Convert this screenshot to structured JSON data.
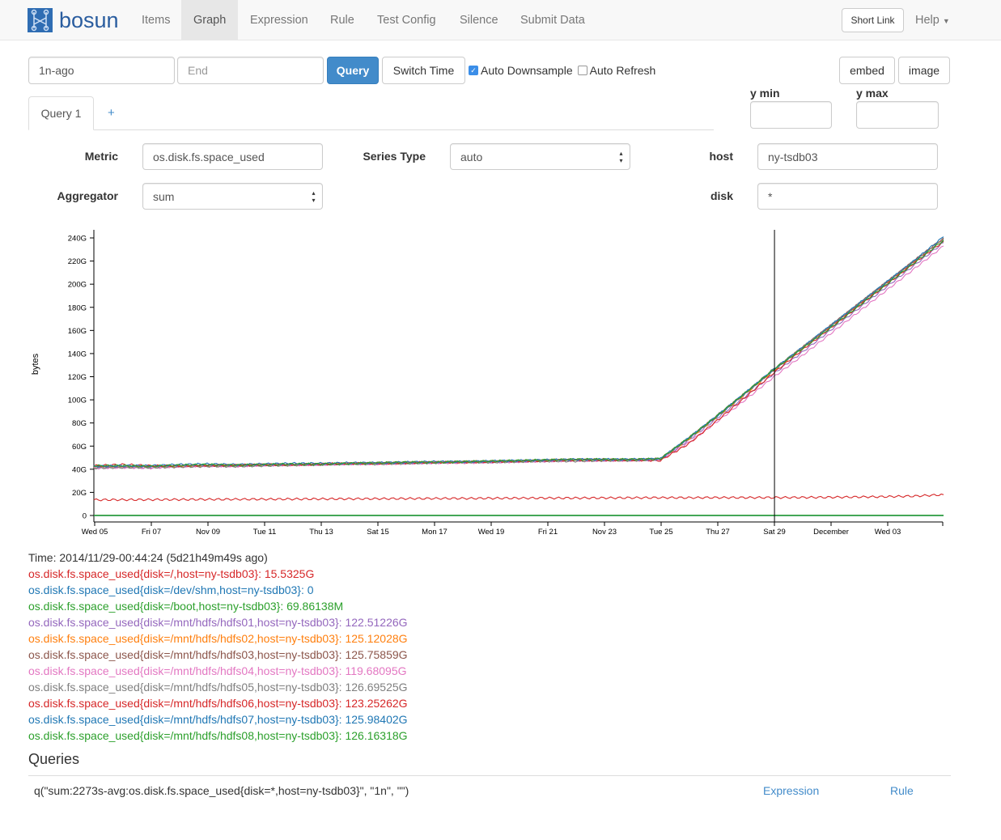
{
  "nav": {
    "brand": "bosun",
    "items": [
      "Items",
      "Graph",
      "Expression",
      "Rule",
      "Test Config",
      "Silence",
      "Submit Data"
    ],
    "active": "Graph",
    "short_link": "Short Link",
    "help": "Help"
  },
  "controls": {
    "start": "1n-ago",
    "end_placeholder": "End",
    "query": "Query",
    "switch_time": "Switch Time",
    "auto_downsample": "Auto Downsample",
    "auto_downsample_checked": true,
    "auto_refresh": "Auto Refresh",
    "auto_refresh_checked": false,
    "embed": "embed",
    "image": "image",
    "ymin_label": "y min",
    "ymax_label": "y max"
  },
  "tabs": {
    "query1": "Query 1",
    "add": "+"
  },
  "form": {
    "metric_label": "Metric",
    "metric": "os.disk.fs.space_used",
    "series_type_label": "Series Type",
    "series_type": "auto",
    "aggregator_label": "Aggregator",
    "aggregator": "sum",
    "tags": [
      {
        "key": "host",
        "value": "ny-tsdb03"
      },
      {
        "key": "disk",
        "value": "*"
      }
    ]
  },
  "chart_data": {
    "type": "line",
    "ylabel": "bytes",
    "ylim": [
      0,
      247
    ],
    "yticks": [
      "0",
      "20G",
      "40G",
      "60G",
      "80G",
      "100G",
      "120G",
      "140G",
      "160G",
      "180G",
      "200G",
      "220G",
      "240G"
    ],
    "xticks": [
      "Wed 05",
      "Fri 07",
      "Nov 09",
      "Tue 11",
      "Thu 13",
      "Sat 15",
      "Mon 17",
      "Wed 19",
      "Fri 21",
      "Nov 23",
      "Tue 25",
      "Thu 27",
      "Sat 29",
      "December",
      "Wed 03"
    ],
    "x": [
      "2014-11-05",
      "2014-11-06",
      "2014-11-07",
      "2014-11-08",
      "2014-11-09",
      "2014-11-10",
      "2014-11-11",
      "2014-11-12",
      "2014-11-13",
      "2014-11-14",
      "2014-11-15",
      "2014-11-16",
      "2014-11-17",
      "2014-11-18",
      "2014-11-19",
      "2014-11-20",
      "2014-11-21",
      "2014-11-22",
      "2014-11-23",
      "2014-11-24",
      "2014-11-25",
      "2014-11-26",
      "2014-11-27",
      "2014-11-28",
      "2014-11-29",
      "2014-11-30",
      "2014-12-01",
      "2014-12-02",
      "2014-12-03",
      "2014-12-04",
      "2014-12-05"
    ],
    "crosshair": "2014-11-29T00:44:24",
    "series": [
      {
        "name": "os.disk.fs.space_used{disk=/,host=ny-tsdb03}",
        "color": "#d62728",
        "values": [
          13.5,
          13.6,
          13.7,
          13.8,
          13.9,
          14,
          14.1,
          14.2,
          14.3,
          14.4,
          14.5,
          14.6,
          14.7,
          14.8,
          14.9,
          15,
          15.1,
          15.1,
          15.2,
          15.3,
          15.4,
          15.4,
          15.5,
          15.5,
          15.53,
          15.6,
          15.8,
          16,
          16.3,
          16.8,
          18
        ]
      },
      {
        "name": "os.disk.fs.space_used{disk=/dev/shm,host=ny-tsdb03}",
        "color": "#1f77b4",
        "values": [
          0,
          0,
          0,
          0,
          0,
          0,
          0,
          0,
          0,
          0,
          0,
          0,
          0,
          0,
          0,
          0,
          0,
          0,
          0,
          0,
          0,
          0,
          0,
          0,
          0,
          0,
          0,
          0,
          0,
          0,
          0
        ]
      },
      {
        "name": "os.disk.fs.space_used{disk=/boot,host=ny-tsdb03}",
        "color": "#2ca02c",
        "values": [
          0.07,
          0.07,
          0.07,
          0.07,
          0.07,
          0.07,
          0.07,
          0.07,
          0.07,
          0.07,
          0.07,
          0.07,
          0.07,
          0.07,
          0.07,
          0.07,
          0.07,
          0.07,
          0.07,
          0.07,
          0.07,
          0.07,
          0.07,
          0.07,
          0.07,
          0.07,
          0.07,
          0.07,
          0.07,
          0.07,
          0.07
        ]
      },
      {
        "name": "os.disk.fs.space_used{disk=/mnt/hdfs/hdfs01,host=ny-tsdb03}",
        "color": "#9467bd",
        "values": [
          42,
          42,
          41.5,
          42.5,
          43,
          43,
          43.5,
          44,
          44,
          44.5,
          45,
          45,
          45.5,
          46,
          46,
          46.5,
          47,
          47.5,
          47.5,
          48,
          48,
          65,
          84,
          103,
          122.5,
          141,
          160,
          179,
          198,
          217,
          236
        ]
      },
      {
        "name": "os.disk.fs.space_used{disk=/mnt/hdfs/hdfs02,host=ny-tsdb03}",
        "color": "#ff7f0e",
        "values": [
          41.5,
          42.5,
          42,
          42.5,
          43,
          43.5,
          44,
          43.5,
          44.5,
          45,
          45.5,
          46,
          46,
          46.5,
          47,
          47,
          48,
          48.5,
          48,
          48.5,
          48.5,
          66,
          85.5,
          105,
          125.1,
          144,
          163,
          182,
          201,
          220,
          239
        ]
      },
      {
        "name": "os.disk.fs.space_used{disk=/mnt/hdfs/hdfs03,host=ny-tsdb03}",
        "color": "#8c564b",
        "values": [
          42,
          42,
          42.5,
          43,
          43,
          43,
          43.5,
          44,
          44,
          45,
          45,
          45.5,
          46,
          46.5,
          46.5,
          47,
          47.5,
          48,
          48.5,
          48,
          49,
          67,
          86,
          106,
          125.8,
          145,
          164,
          183,
          202,
          221,
          240
        ]
      },
      {
        "name": "os.disk.fs.space_used{disk=/mnt/hdfs/hdfs04,host=ny-tsdb03}",
        "color": "#e377c2",
        "values": [
          41,
          41.5,
          41,
          42.5,
          43,
          42.5,
          43.5,
          43.5,
          44,
          44.5,
          44.5,
          45,
          45.5,
          45.5,
          46,
          46.5,
          47,
          47.5,
          47.5,
          47.5,
          48,
          63,
          81,
          100,
          119.7,
          138,
          157,
          176,
          195,
          214,
          233
        ]
      },
      {
        "name": "os.disk.fs.space_used{disk=/mnt/hdfs/hdfs05,host=ny-tsdb03}",
        "color": "#7f7f7f",
        "values": [
          41,
          41.5,
          41.5,
          42,
          42.5,
          42.5,
          43,
          43.5,
          44,
          44.5,
          44.5,
          45,
          45.5,
          46,
          46,
          46.5,
          47,
          47,
          47.5,
          47.5,
          48.5,
          67,
          86.5,
          106,
          126.7,
          145,
          164,
          183,
          202,
          221,
          239
        ]
      },
      {
        "name": "os.disk.fs.space_used{disk=/mnt/hdfs/hdfs06,host=ny-tsdb03}",
        "color": "#d62728",
        "values": [
          43,
          44,
          43,
          43,
          43.5,
          43.5,
          44,
          44,
          44.5,
          45,
          45,
          45.5,
          46,
          46,
          46.5,
          47,
          47.5,
          48,
          48,
          48,
          47.5,
          62,
          82,
          102,
          123.3,
          143,
          162,
          181,
          200,
          219,
          237
        ]
      },
      {
        "name": "os.disk.fs.space_used{disk=/mnt/hdfs/hdfs07,host=ny-tsdb03}",
        "color": "#1f77b4",
        "values": [
          42.5,
          43,
          43,
          44,
          44.5,
          44,
          44.5,
          45,
          45,
          45.5,
          45.5,
          46,
          46.5,
          46.5,
          47,
          47.5,
          48,
          48.5,
          48.5,
          48.5,
          49,
          67,
          86,
          106,
          126,
          145,
          164,
          183,
          202,
          221,
          241
        ]
      },
      {
        "name": "os.disk.fs.space_used{disk=/mnt/hdfs/hdfs08,host=ny-tsdb03}",
        "color": "#2ca02c",
        "values": [
          43,
          43,
          42.5,
          43.5,
          44,
          43.5,
          44,
          44.5,
          44.5,
          45,
          45.5,
          46,
          46,
          46.5,
          47,
          47.5,
          48,
          48.5,
          48.5,
          48.5,
          49,
          67,
          86,
          106,
          126.2,
          144,
          162,
          181,
          200,
          219,
          238
        ]
      }
    ]
  },
  "legend": {
    "time": "Time: 2014/11/29-00:44:24 (5d21h49m49s ago)",
    "entries": [
      {
        "text": "os.disk.fs.space_used{disk=/,host=ny-tsdb03}: 15.5325G",
        "color": "#d62728"
      },
      {
        "text": "os.disk.fs.space_used{disk=/dev/shm,host=ny-tsdb03}: 0",
        "color": "#1f77b4"
      },
      {
        "text": "os.disk.fs.space_used{disk=/boot,host=ny-tsdb03}: 69.86138M",
        "color": "#2ca02c"
      },
      {
        "text": "os.disk.fs.space_used{disk=/mnt/hdfs/hdfs01,host=ny-tsdb03}: 122.51226G",
        "color": "#9467bd"
      },
      {
        "text": "os.disk.fs.space_used{disk=/mnt/hdfs/hdfs02,host=ny-tsdb03}: 125.12028G",
        "color": "#ff7f0e"
      },
      {
        "text": "os.disk.fs.space_used{disk=/mnt/hdfs/hdfs03,host=ny-tsdb03}: 125.75859G",
        "color": "#8c564b"
      },
      {
        "text": "os.disk.fs.space_used{disk=/mnt/hdfs/hdfs04,host=ny-tsdb03}: 119.68095G",
        "color": "#e377c2"
      },
      {
        "text": "os.disk.fs.space_used{disk=/mnt/hdfs/hdfs05,host=ny-tsdb03}: 126.69525G",
        "color": "#7f7f7f"
      },
      {
        "text": "os.disk.fs.space_used{disk=/mnt/hdfs/hdfs06,host=ny-tsdb03}: 123.25262G",
        "color": "#d62728"
      },
      {
        "text": "os.disk.fs.space_used{disk=/mnt/hdfs/hdfs07,host=ny-tsdb03}: 125.98402G",
        "color": "#1f77b4"
      },
      {
        "text": "os.disk.fs.space_used{disk=/mnt/hdfs/hdfs08,host=ny-tsdb03}: 126.16318G",
        "color": "#2ca02c"
      }
    ]
  },
  "queries": {
    "heading": "Queries",
    "rows": [
      {
        "query": "q(\"sum:2273s-avg:os.disk.fs.space_used{disk=*,host=ny-tsdb03}\", \"1n\", \"\")",
        "expression": "Expression",
        "rule": "Rule"
      }
    ]
  }
}
